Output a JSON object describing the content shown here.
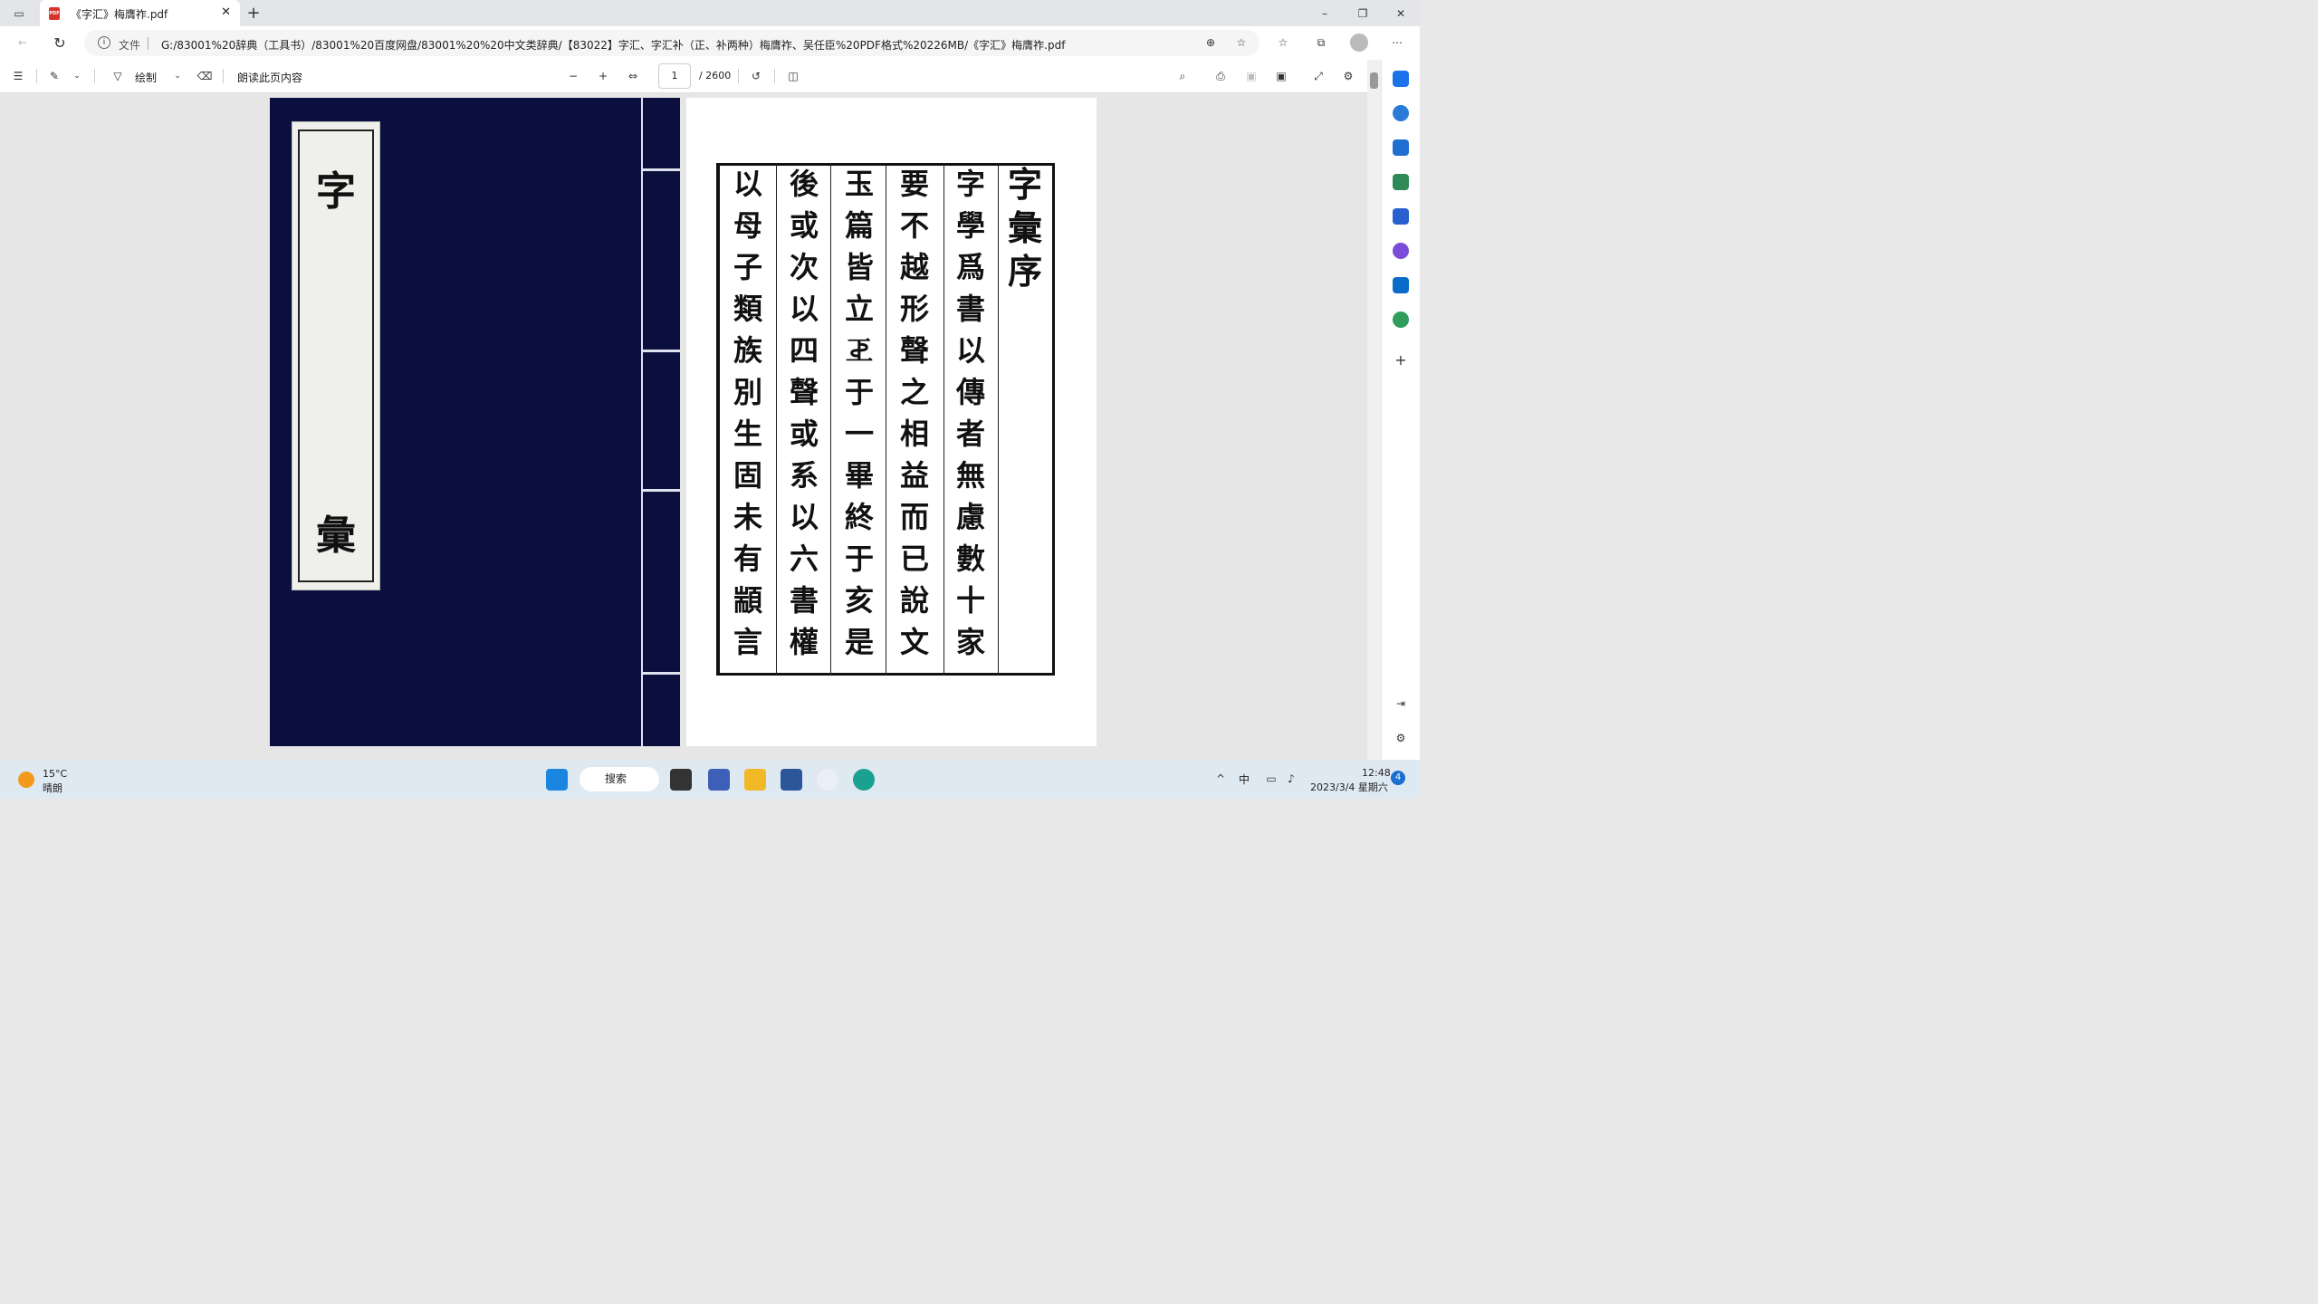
{
  "browser": {
    "tab_title": "《字汇》梅膺祚.pdf",
    "pdf_badge": "PDF",
    "address_label": "文件",
    "url": "G:/83001%20辞典（工具书）/83001%20百度网盘/83001%20%20中文类辞典/【83022】字汇、字汇补（正、补两种）梅膺祚、吴任臣%20PDF格式%20226MB/《字汇》梅膺祚.pdf"
  },
  "pdf_toolbar": {
    "draw_label": "绘制",
    "read_aloud_label": "朗读此页内容",
    "page_current": "1",
    "page_total": "/ 2600"
  },
  "cover": {
    "char1": "字",
    "char2": "彙"
  },
  "page": {
    "columns": [
      "字彙序",
      "字學爲書以傳者無慮數十家",
      "要不越形聲之相益而已說文",
      "玉篇皆立𢀓于一畢終于亥是",
      "後或次以四聲或系以六書權",
      "以母子類族別生固未有顓言"
    ]
  },
  "taskbar": {
    "temp": "15°C",
    "weather": "晴朗",
    "search_label": "搜索",
    "ime": "中",
    "time": "12:48",
    "date": "2023/3/4 星期六",
    "notif_count": "4"
  }
}
